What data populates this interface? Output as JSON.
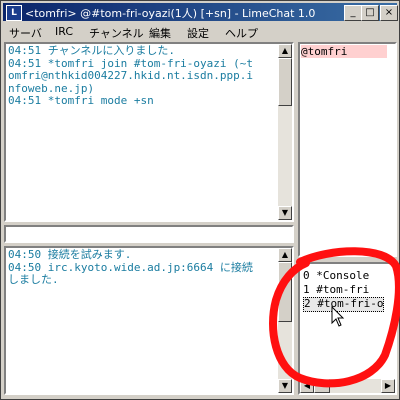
{
  "window": {
    "title": "<tomfri> @#tom-fri-oyazi(1人) [+sn]  - LimeChat 1.0",
    "app_icon_glyph": "L",
    "min_label": "_",
    "max_label": "□",
    "close_label": "×"
  },
  "menu": [
    "サーバ",
    "IRC",
    "チャンネル",
    "編集",
    "設定",
    "ヘルプ"
  ],
  "channel_log": [
    "04:51 チャンネルに入りました.",
    "04:51 *tomfri join #tom-fri-oyazi (~t",
    "omfri@nthkid004227.hkid.nt.isdn.ppp.i",
    "nfoweb.ne.jp)",
    "04:51 *tomfri mode +sn"
  ],
  "input": {
    "value": ""
  },
  "console_log": [
    "04:50 接続を試みます.",
    "04:50 irc.kyoto.wide.ad.jp:6664 に接続",
    "しました."
  ],
  "members": [
    "@tomfri"
  ],
  "channels": [
    {
      "text": "0 *Console",
      "selected": false
    },
    {
      "text": "1 #tom-fri",
      "selected": false
    },
    {
      "text": "2 #tom-fri-o",
      "selected": true
    }
  ],
  "colors": {
    "log_text": "#1a7ca0",
    "member_highlight": "#ffd0d0",
    "titlebar_start": "#0a246a",
    "annotation": "#ff1010"
  },
  "icons": {
    "scroll_up": "▲",
    "scroll_down": "▼",
    "scroll_left": "◀",
    "scroll_right": "▶"
  }
}
